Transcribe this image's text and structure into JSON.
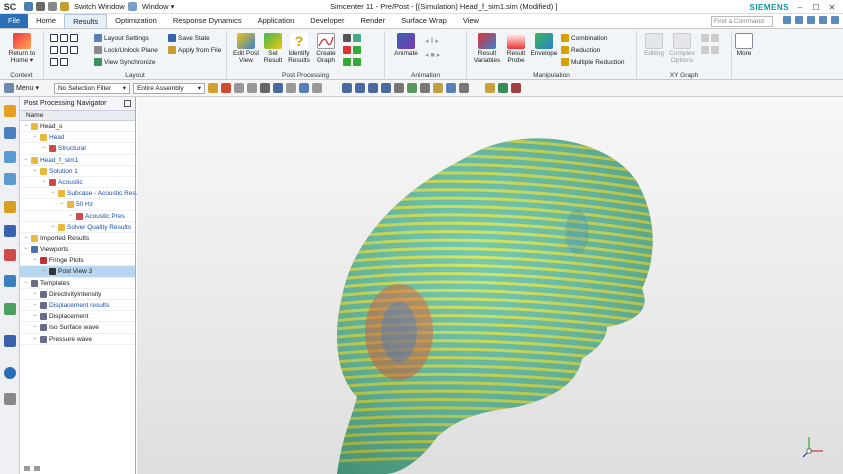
{
  "app": {
    "logo": "SC",
    "title": "Simcenter 11 - Pre/Post - [(Simulation) Head_f_sim1.sim (Modified) ]",
    "brand": "SIEMENS",
    "switch_window": "Switch Window",
    "window_menu": "Window ▾"
  },
  "tabs": [
    "File",
    "Home",
    "Results",
    "Optimization",
    "Response Dynamics",
    "Application",
    "Developer",
    "Render",
    "Surface Wrap",
    "View"
  ],
  "active_tab": "Results",
  "command_search": {
    "placeholder": "Find a Command"
  },
  "ribbon": {
    "context": {
      "label": "Context",
      "return_home": "Return to Home ▾"
    },
    "layout": {
      "label": "Layout",
      "items": [
        "Layout Settings",
        "Lock/Unlock Plane",
        "View Synchronize",
        "Save State",
        "Apply from File"
      ]
    },
    "post_processing": {
      "label": "Post Processing",
      "buttons": [
        "Edit Post View",
        "Set Result",
        "Identify Results",
        "Create Graph"
      ]
    },
    "animation": {
      "label": "Animation",
      "animate": "Animate"
    },
    "manipulation": {
      "label": "Manipulation",
      "buttons": [
        "Result Variables",
        "Result Probe",
        "Envelope"
      ],
      "items": [
        "Combination",
        "Reduction",
        "Multiple Reduction"
      ]
    },
    "xy_graph": {
      "label": "XY Graph",
      "buttons": [
        "Editing",
        "Complex Options"
      ]
    },
    "more": "More"
  },
  "toolbar": {
    "menu": "Menu ▾",
    "selection_filter": "No Selection Filter",
    "assembly_scope": "Entire Assembly"
  },
  "navigator": {
    "title": "Post Processing Navigator",
    "column": "Name",
    "nodes": [
      {
        "label": "Head_s",
        "level": 0,
        "icon": "folder"
      },
      {
        "label": "Head",
        "level": 1,
        "icon": "folder",
        "link": true
      },
      {
        "label": "Structural",
        "level": 2,
        "icon": "result",
        "link": true
      },
      {
        "label": "Head_f_sim1",
        "level": 0,
        "icon": "folder",
        "link": true
      },
      {
        "label": "Solution 1",
        "level": 1,
        "icon": "folder",
        "link": true
      },
      {
        "label": "Acoustic",
        "level": 2,
        "icon": "result",
        "link": true
      },
      {
        "label": "Subcase - Acoustic Res...",
        "level": 3,
        "icon": "folder",
        "link": true
      },
      {
        "label": "50 Hz",
        "level": 4,
        "icon": "folder",
        "link": true
      },
      {
        "label": "Acoustic Pres",
        "level": 5,
        "icon": "result",
        "link": true
      },
      {
        "label": "Solver Quality Results",
        "level": 3,
        "icon": "folder",
        "link": true
      },
      {
        "label": "Imported Results",
        "level": 0,
        "icon": "folder"
      },
      {
        "label": "Viewports",
        "level": 0,
        "icon": "viewport"
      },
      {
        "label": "Fringe Plots",
        "level": 1,
        "icon": "fringe"
      },
      {
        "label": "Post View 3",
        "level": 2,
        "icon": "view",
        "selected": true
      },
      {
        "label": "Templates",
        "level": 0,
        "icon": "template"
      },
      {
        "label": "DirectivityIntensity",
        "level": 1,
        "icon": "template"
      },
      {
        "label": "Displacement results",
        "level": 1,
        "icon": "template",
        "link": true
      },
      {
        "label": "Displacement",
        "level": 1,
        "icon": "template"
      },
      {
        "label": "Iso Surface wave",
        "level": 1,
        "icon": "template"
      },
      {
        "label": "Pressure wave",
        "level": 1,
        "icon": "template"
      }
    ]
  },
  "colors": {
    "accent": "#2a6eb5",
    "brand": "#0a9aa0",
    "selection": "#b7d5ee",
    "fringe_base": "#5cc0a0",
    "fringe_band": "#e2e63a",
    "fringe_hot": "#e05a2a"
  }
}
